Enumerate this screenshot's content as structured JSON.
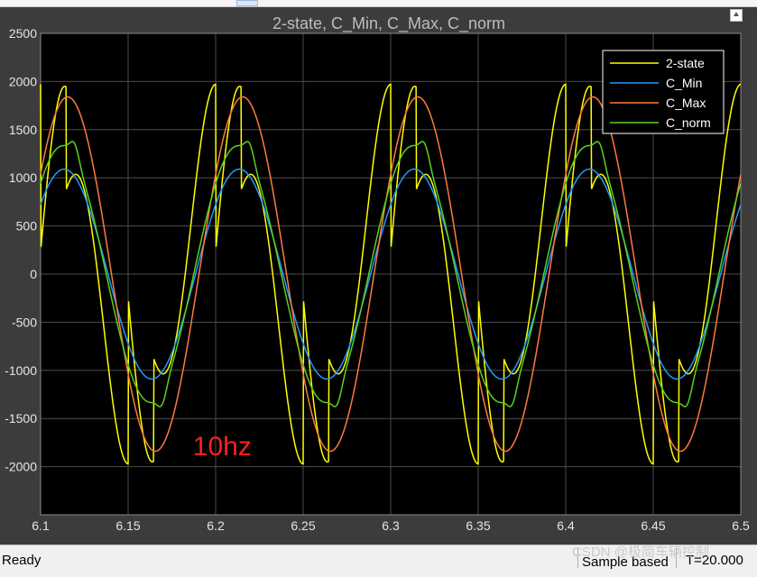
{
  "window": {
    "status_ready": "Ready",
    "status_mode": "Sample based",
    "status_time": "T=20.000",
    "watermark": "CSDN @极简车辆控制"
  },
  "colors": {
    "background": "#000000",
    "frame": "#3c3c3c",
    "grid": "#4d4d4d",
    "title": "#bdbdbd",
    "annotation": "#ff2020"
  },
  "chart_data": {
    "type": "line",
    "title": "2-state, C_Min, C_Max, C_norm",
    "xlabel": "",
    "ylabel": "",
    "xlim": [
      6.1,
      6.5
    ],
    "ylim": [
      -2500,
      2500
    ],
    "grid": true,
    "legend": "top-right",
    "xticks": [
      "6.1",
      "6.15",
      "6.2",
      "6.25",
      "6.3",
      "6.35",
      "6.4",
      "6.45",
      "6.5"
    ],
    "xtick_values": [
      6.1,
      6.15,
      6.2,
      6.25,
      6.3,
      6.35,
      6.4,
      6.45,
      6.5
    ],
    "yticks": [
      "2500",
      "2000",
      "1500",
      "1000",
      "500",
      "0",
      "-500",
      "-1000",
      "-1500",
      "-2000"
    ],
    "ytick_values": [
      2500,
      2000,
      1500,
      1000,
      500,
      0,
      -500,
      -1000,
      -1500,
      -2000
    ],
    "annotation": {
      "text": "10hz",
      "x": 6.187,
      "y": -1880
    },
    "frequency_hz": 10,
    "series": [
      {
        "name": "2-state",
        "color": "#ffff00",
        "amplitude": 1950,
        "peak_time": 6.1115,
        "drop_to": 870
      },
      {
        "name": "C_Min",
        "color": "#1e9bff",
        "amplitude": 1090,
        "peak_time": 6.1135
      },
      {
        "name": "C_Max",
        "color": "#ff7a3d",
        "amplitude": 1840,
        "peak_time": 6.1155
      },
      {
        "name": "C_norm",
        "color": "#5ad21e",
        "amplitude": 1330,
        "peak_time": 6.1125,
        "secondary_amplitude": 150,
        "secondary_peak_time": 6.1195
      }
    ]
  }
}
